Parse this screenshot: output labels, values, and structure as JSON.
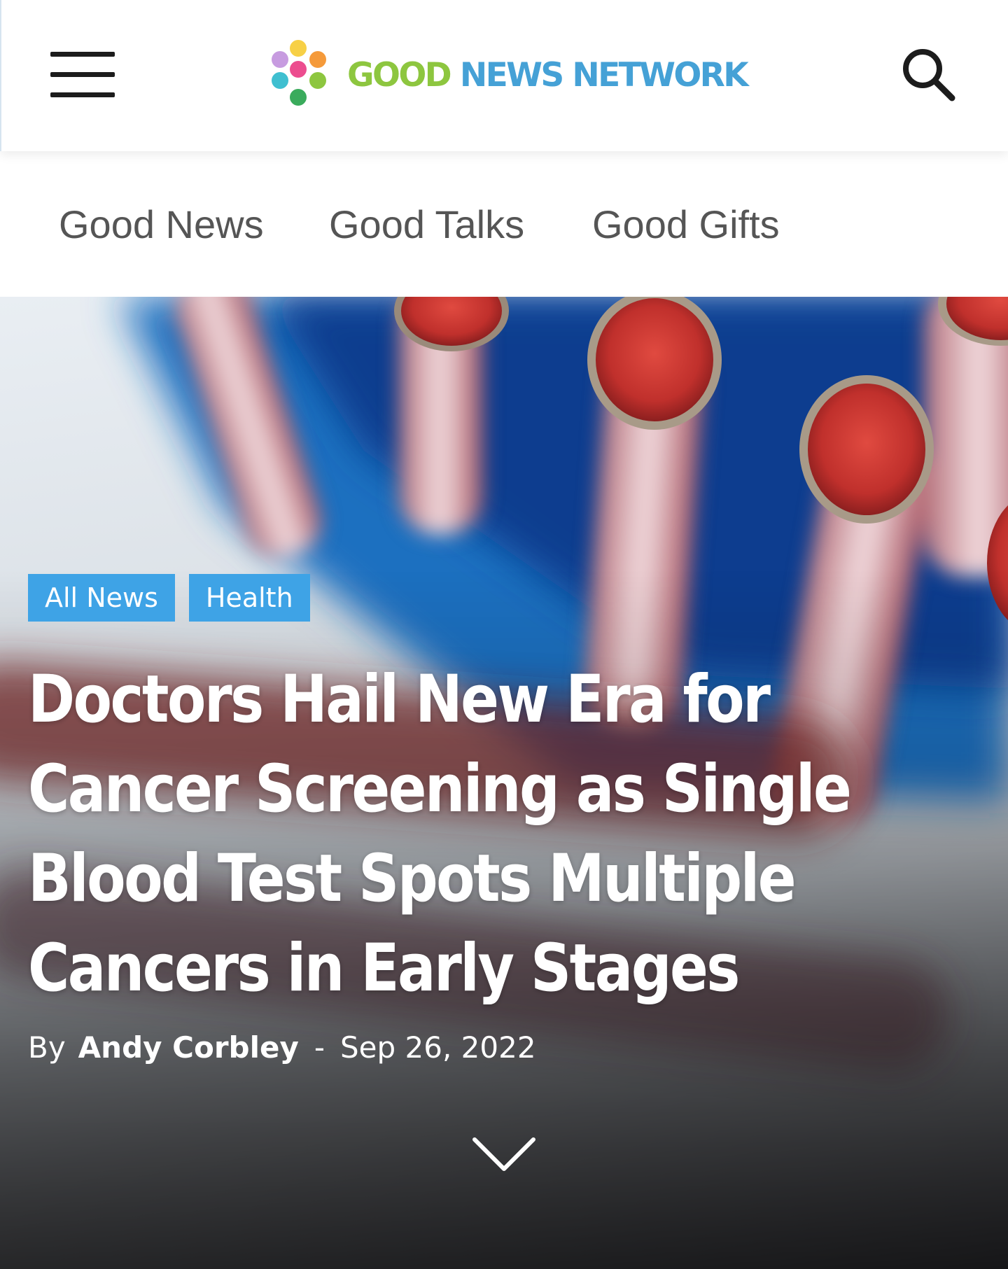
{
  "header": {
    "menu_icon": "hamburger-icon",
    "logo_word_good": "GOOD",
    "logo_word_rest": "NEWS NETWORK",
    "search_icon": "search-icon",
    "colors": {
      "logo_green": "#8dc63f",
      "logo_blue": "#45a1d6"
    }
  },
  "nav": {
    "items": [
      {
        "label": "Good News"
      },
      {
        "label": "Good Talks"
      },
      {
        "label": "Good Gifts"
      }
    ]
  },
  "article": {
    "tags": [
      {
        "label": "All News"
      },
      {
        "label": "Health"
      }
    ],
    "title": "Doctors Hail New Era for Cancer Screening as Single Blood Test Spots Multiple Cancers in Early Stages",
    "byline_prefix": "By",
    "author": "Andy Corbley",
    "separator": "-",
    "date": "Sep 26, 2022",
    "scroll_icon": "chevron-down-icon",
    "colors": {
      "tag_bg": "#3ea3e6"
    }
  }
}
